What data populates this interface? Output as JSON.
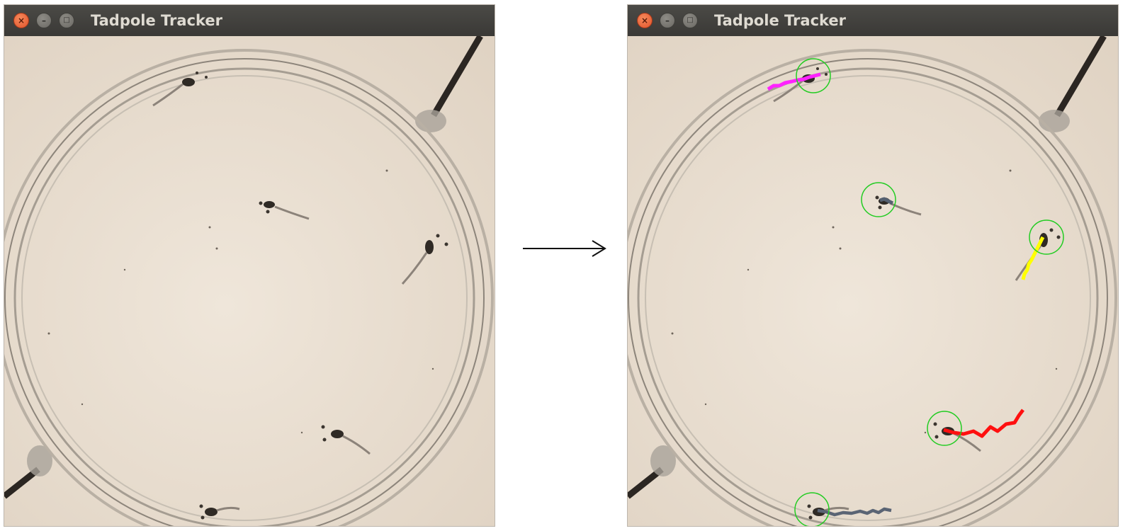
{
  "left_window": {
    "title": "Tadpole Tracker",
    "buttons": {
      "close": "×",
      "minimize": "–",
      "maximize": "□"
    }
  },
  "right_window": {
    "title": "Tadpole Tracker",
    "buttons": {
      "close": "×",
      "minimize": "–",
      "maximize": "□"
    },
    "detection_circle_color": "#22cc22",
    "track_colors": [
      "#ff22ff",
      "#556070",
      "#ffff00",
      "#ff1010",
      "#5a6474"
    ]
  },
  "transition_arrow": "right-arrow-icon",
  "colors": {
    "background_sand": "#e9dfd2",
    "titlebar": "#3f3e3a",
    "close_button": "#e95420"
  }
}
